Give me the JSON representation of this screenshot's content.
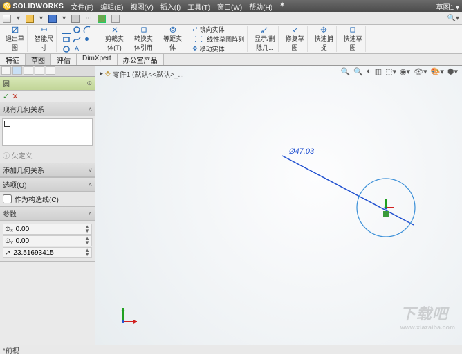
{
  "title": {
    "brand": "SOLIDWORKS",
    "right": "草图1 ▾"
  },
  "menubar": {
    "items": [
      "文件(F)",
      "编辑(E)",
      "视图(V)",
      "插入(I)",
      "工具(T)",
      "窗口(W)",
      "帮助(H)"
    ]
  },
  "ribbon": {
    "btns": [
      {
        "label1": "退出草",
        "label2": "图"
      },
      {
        "label1": "智能尺",
        "label2": "寸"
      }
    ],
    "grp2": [
      {
        "label1": "剪裁实",
        "label2": "体(T)"
      },
      {
        "label1": "转换实",
        "label2": "体引用"
      },
      {
        "label1": "等距实",
        "label2": "体"
      }
    ],
    "grp3_top": "镜向实体",
    "grp3_mid": "线性草图阵列",
    "grp3_bot": "移动实体",
    "grp4": [
      {
        "label1": "显示/删",
        "label2": "除几..."
      },
      {
        "label1": "修复草",
        "label2": "图"
      },
      {
        "label1": "快速捕",
        "label2": "捉"
      },
      {
        "label1": "快速草",
        "label2": "图"
      }
    ]
  },
  "cmdtabs": {
    "items": [
      "特征",
      "草图",
      "评估",
      "DimXpert",
      "办公室产品"
    ],
    "active": 1
  },
  "fm": {
    "pm_title": "圆",
    "ok": "✓",
    "sec_relations": "现有几何关系",
    "undef": "欠定义",
    "sec_addrel": "添加几何关系",
    "sec_options": "选项(O)",
    "chk_construction": "作为构造线(C)",
    "sec_params": "参数",
    "params": {
      "cx": "0.00",
      "cy": "0.00",
      "r": "23.51693415"
    }
  },
  "doc": {
    "crumb": "零件1 (默认<<默认>_..."
  },
  "sketch": {
    "diameter": "Ø47.03"
  },
  "status": {
    "text": "*前视"
  },
  "watermark": {
    "main": "下载吧",
    "sub": "www.xiazaiba.com"
  }
}
